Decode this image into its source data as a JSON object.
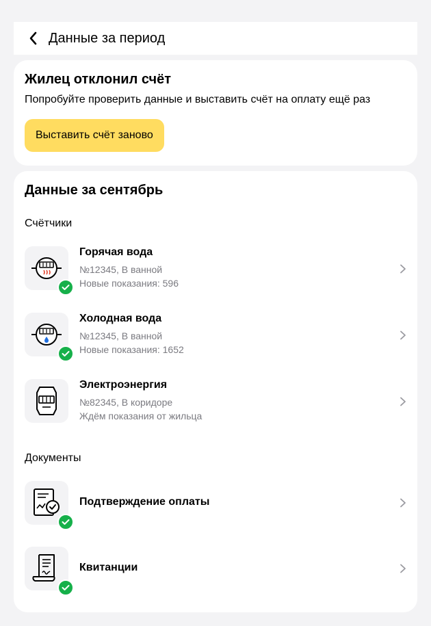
{
  "header": {
    "title": "Данные за период",
    "back_icon": "chevron-left-icon"
  },
  "notice": {
    "title": "Жилец отклонил счёт",
    "text": "Попробуйте проверить данные и выставить счёт на оплату ещё раз",
    "button_label": "Выставить счёт заново",
    "button_color": "#ffdc60"
  },
  "period": {
    "title": "Данные за сентябрь",
    "meters_section": "Счётчики",
    "meters": [
      {
        "icon": "hot-water-meter-icon",
        "title": "Горячая вода",
        "line1": "№12345, В ванной",
        "line2": "Новые показания: 596",
        "checked": true
      },
      {
        "icon": "cold-water-meter-icon",
        "title": "Холодная вода",
        "line1": "№12345, В ванной",
        "line2": "Новые показания: 1652",
        "checked": true
      },
      {
        "icon": "electricity-meter-icon",
        "title": "Электроэнергия",
        "line1": "№82345, В коридоре",
        "line2": "Ждём показания от жильца",
        "checked": false
      }
    ],
    "documents_section": "Документы",
    "documents": [
      {
        "icon": "payment-confirmation-icon",
        "title": "Подтверждение оплаты",
        "checked": true
      },
      {
        "icon": "receipt-icon",
        "title": "Квитанции",
        "checked": true
      }
    ]
  },
  "colors": {
    "accent": "#ffdc60",
    "success": "#16b04a",
    "secondary_text": "#7a7a80",
    "background": "#f3f3f5"
  }
}
